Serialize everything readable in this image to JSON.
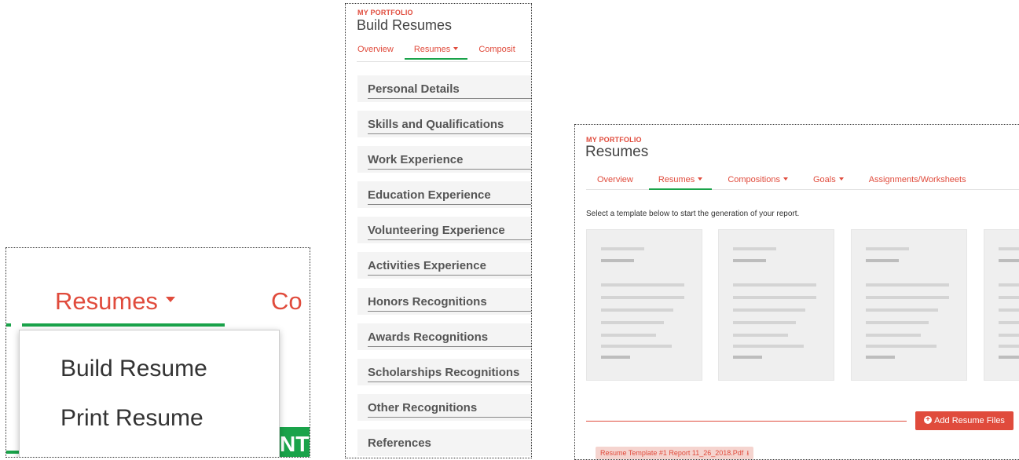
{
  "panel_dropdown": {
    "tab_label": "Resumes",
    "next_tab_partial": "Co",
    "menu_items": [
      "Build Resume",
      "Print Resume"
    ],
    "partial_button_text": "NT"
  },
  "panel_build": {
    "kicker": "MY PORTFOLIO",
    "title": "Build Resumes",
    "tabs": [
      "Overview",
      "Resumes",
      "Composit"
    ],
    "sections": [
      "Personal Details",
      "Skills and Qualifications",
      "Work Experience",
      "Education Experience",
      "Volunteering Experience",
      "Activities Experience",
      "Honors Recognitions",
      "Awards Recognitions",
      "Scholarships Recognitions",
      "Other Recognitions",
      "References"
    ]
  },
  "panel_templates": {
    "kicker": "MY PORTFOLIO",
    "title": "Resumes",
    "tabs": [
      "Overview",
      "Resumes",
      "Compositions",
      "Goals",
      "Assignments/Worksheets"
    ],
    "instruction": "Select a template below to start the generation of your report.",
    "add_button": "Add Resume Files",
    "file_name": "Resume Template #1 Report 11_26_2018.Pdf"
  },
  "colors": {
    "accent_red": "#e04b3c",
    "active_green": "#1aa34a",
    "section_bg": "#f4f4f4"
  }
}
